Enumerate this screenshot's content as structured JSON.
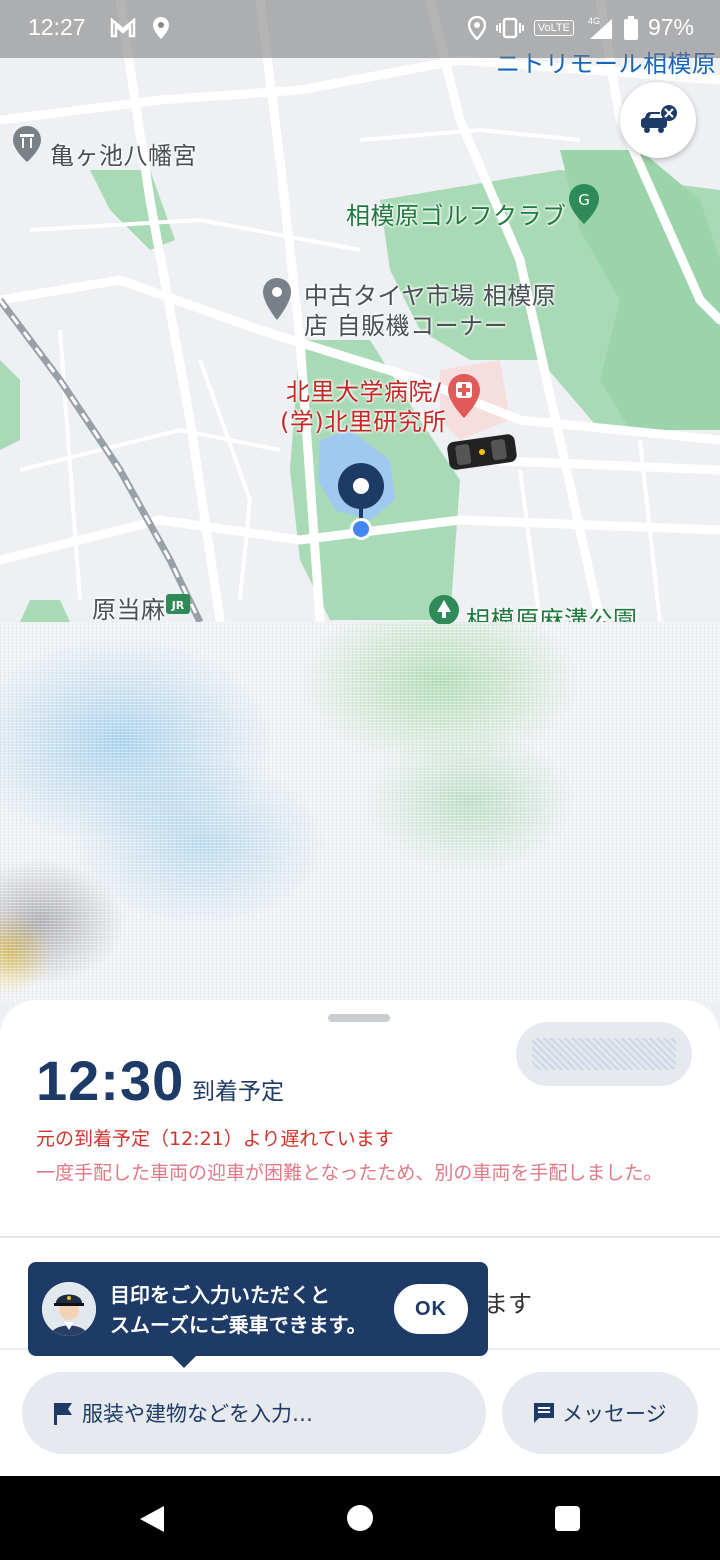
{
  "status_bar": {
    "time": "12:27",
    "battery": "97%",
    "network": "VoLTE",
    "signal": "4G",
    "icons": [
      "gmail-icon",
      "location-icon",
      "location-icon",
      "vibrate-icon",
      "signal-icon",
      "battery-icon"
    ]
  },
  "map": {
    "labels": {
      "nitori": "ニトリモール相模原",
      "kamegaike": "亀ヶ池八幡宮",
      "golf": "相模原ゴルフクラブ",
      "tire_1": "中古タイヤ市場 相模原",
      "tire_2": "店 自販機コーナー",
      "hospital_1": "北里大学病院/",
      "hospital_2": "(学)北里研究所",
      "harataima": "原当麻",
      "park": "相模原麻溝公園"
    },
    "colors": {
      "park": "#a8dab5",
      "water": "#9fc9f0",
      "road": "#ffffff",
      "pin": "#1e3a66",
      "current": "#4285f4"
    }
  },
  "sheet": {
    "eta_time": "12:30",
    "eta_label": "到着予定",
    "delay_notice": "元の到着予定（12:21）より遅れています",
    "reassign_notice": "一度手配した車両の迎車が困難となったため、別の車両を手配しました。",
    "partial_text": "ます"
  },
  "tooltip": {
    "line1": "目印をご入力いただくと",
    "line2": "スムーズにご乗車できます。",
    "ok_label": "OK"
  },
  "actions": {
    "landmark_placeholder": "服装や建物などを入力…",
    "message_label": "メッセージ"
  },
  "theme": {
    "navy": "#1e3a66",
    "red": "#d0342c",
    "pink": "#e07a86"
  }
}
